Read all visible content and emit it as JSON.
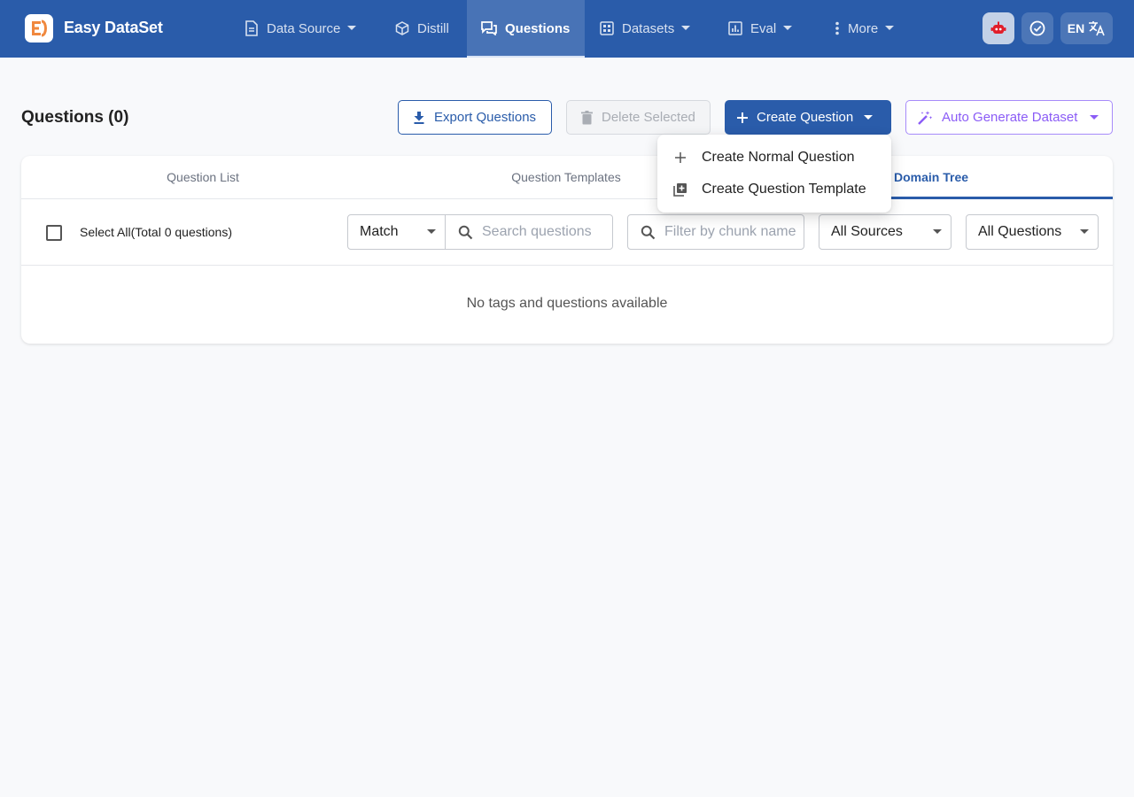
{
  "app": {
    "name": "Easy DataSet"
  },
  "nav": {
    "data_source": "Data Source",
    "distill": "Distill",
    "questions": "Questions",
    "datasets": "Datasets",
    "eval": "Eval",
    "more": "More"
  },
  "toolbar": {
    "language": "EN"
  },
  "page": {
    "title": "Questions (0)"
  },
  "actions": {
    "export": "Export Questions",
    "delete": "Delete Selected",
    "create": "Create Question",
    "auto_generate": "Auto Generate Dataset"
  },
  "menu": {
    "items": [
      "Create Normal Question",
      "Create Question Template"
    ]
  },
  "tabs": [
    "Question List",
    "Question Templates",
    "Domain Tree"
  ],
  "filters": {
    "select_all": "Select All(Total 0 questions)",
    "match_mode": "Match",
    "search_placeholder": "Search questions",
    "chunk_placeholder": "Filter by chunk name",
    "sources": "All Sources",
    "status": "All Questions"
  },
  "empty_message": "No tags and questions available",
  "colors": {
    "primary": "#2a5caa",
    "accent_purple": "#8b5cf6",
    "background": "#f8f9fb"
  }
}
